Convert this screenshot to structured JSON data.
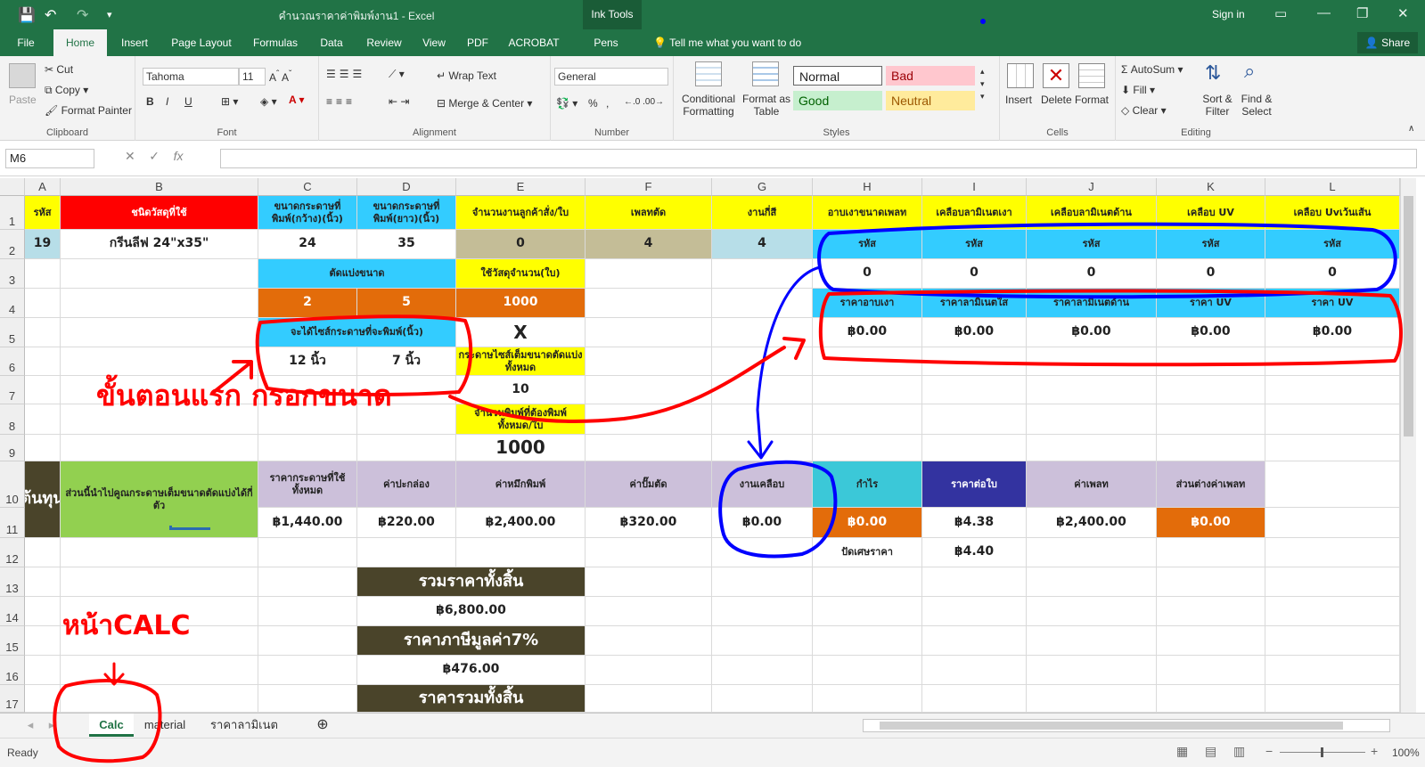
{
  "titlebar": {
    "title": "คำนวณราคาค่าพิมพ์งาน1 - Excel",
    "ink_tools": "Ink Tools",
    "sign_in": "Sign in"
  },
  "tabs": [
    "File",
    "Home",
    "Insert",
    "Page Layout",
    "Formulas",
    "Data",
    "Review",
    "View",
    "PDF",
    "ACROBAT",
    "Pens"
  ],
  "tell_me": "Tell me what you want to do",
  "share": "Share",
  "ribbon": {
    "clipboard": {
      "paste": "Paste",
      "cut": "Cut",
      "copy": "Copy",
      "format_painter": "Format Painter",
      "label": "Clipboard"
    },
    "font": {
      "name": "Tahoma",
      "size": "11",
      "bold": "B",
      "italic": "I",
      "underline": "U",
      "label": "Font"
    },
    "alignment": {
      "wrap": "Wrap Text",
      "merge": "Merge & Center",
      "label": "Alignment"
    },
    "number": {
      "format": "General",
      "percent": "%",
      "comma": ",",
      "label": "Number"
    },
    "styles": {
      "conditional": "Conditional Formatting",
      "format_table": "Format as Table",
      "normal": "Normal",
      "bad": "Bad",
      "good": "Good",
      "neutral": "Neutral",
      "label": "Styles"
    },
    "cells": {
      "insert": "Insert",
      "delete": "Delete",
      "format": "Format",
      "label": "Cells"
    },
    "editing": {
      "autosum": "AutoSum",
      "fill": "Fill",
      "clear": "Clear",
      "sort": "Sort & Filter",
      "find": "Find & Select",
      "label": "Editing"
    }
  },
  "formula_bar": {
    "name_box": "M6",
    "fx": "fx",
    "value": ""
  },
  "columns": [
    "A",
    "B",
    "C",
    "D",
    "E",
    "F",
    "G",
    "H",
    "I",
    "J",
    "K",
    "L"
  ],
  "rows": [
    "1",
    "2",
    "3",
    "4",
    "5",
    "6",
    "7",
    "8",
    "9",
    "10",
    "11",
    "12",
    "13",
    "14",
    "15",
    "16",
    "17"
  ],
  "cells": {
    "A1": "รหัส",
    "B1": "ชนิดวัสดุที่ใช้",
    "C1": "ขนาดกระดาษที่พิมพ์(กว้าง)(นิ้ว)",
    "D1": "ขนาดกระดาษที่พิมพ์(ยาว)(นิ้ว)",
    "E1": "จำนวนงานลูกค้าสั่ง/ใบ",
    "F1": "เพลทตัด",
    "G1": "งานกี่สี",
    "H1": "อาบเงาขนาดเพลท",
    "I1": "เคลือบลามิเนตเงา",
    "J1": "เคลือบลามิเนตด้าน",
    "K1": "เคลือบ UV",
    "L1": "เคลือบ Uvเว้นเส้น",
    "A2": "19",
    "B2": "กรีนลีฟ 24\"x35\"",
    "C2": "24",
    "D2": "35",
    "E2": "0",
    "F2": "4",
    "G2": "4",
    "H2": "รหัส",
    "I2": "รหัส",
    "J2": "รหัส",
    "K2": "รหัส",
    "L2": "รหัส",
    "C3": "ตัดแบ่งขนาด",
    "E3": "ใช้วัสดุจำนวน(ใบ)",
    "H3": "0",
    "I3": "0",
    "J3": "0",
    "K3": "0",
    "L3": "0",
    "C4": "2",
    "D4": "5",
    "E4": "1000",
    "H4": "ราคาอาบเงา",
    "I4": "ราคาลามิเนตใส",
    "J4": "ราคาลามิเนตด้าน",
    "K4": "ราคา UV",
    "L4": "ราคา UV",
    "C5": "จะได้ไซส์กระดาษที่จะพิมพ์(นิ้ว)",
    "E5": "X",
    "H5": "฿0.00",
    "I5": "฿0.00",
    "J5": "฿0.00",
    "K5": "฿0.00",
    "L5": "฿0.00",
    "C6": "12 นิ้ว",
    "D6": "7 นิ้ว",
    "E6": "กระดาษไซส์เต็มขนาดตัดแบ่งทั้งหมด",
    "E7": "10",
    "E8": "จำนวนพิมพ์ที่ต้องพิมพ์ทั้งหมด/ใบ",
    "E9": "1000",
    "A10": "ต้นทุน",
    "B10": "ส่วนนี้นำไปคูณกระดาษเต็มขนาดตัดแบ่งได้กี่ตัว",
    "C10": "ราคากระดาษที่ใช้ทั้งหมด",
    "D10": "ค่าปะกล่อง",
    "E10": "ค่าหมึกพิมพ์",
    "F10": "ค่าปั๊มตัด",
    "G10": "งานเคลือบ",
    "H10": "กำไร",
    "I10": "ราคาต่อใบ",
    "J10": "ค่าเพลท",
    "K10": "ส่วนต่างค่าเพลท",
    "C11": "฿1,440.00",
    "D11": "฿220.00",
    "E11": "฿2,400.00",
    "F11": "฿320.00",
    "G11": "฿0.00",
    "H11": "฿0.00",
    "I11": "฿4.38",
    "J11": "฿2,400.00",
    "K11": "฿0.00",
    "H12": "ปัดเศษราคา",
    "I12": "฿4.40",
    "D13": "รวมราคาทั้งสิ้น",
    "D14": "฿6,800.00",
    "D15": "ราคาภาษีมูลค่า7%",
    "D16": "฿476.00",
    "D17": "ราคารวมทั้งสิ้น"
  },
  "annotations": {
    "left_note": "ขั้นตอนแรก กรอกขนาด",
    "calc_note": "หน้าCALC"
  },
  "sheet_tabs": [
    "Calc",
    "material",
    "ราคาลามิเนต"
  ],
  "status": {
    "ready": "Ready",
    "zoom": "100%"
  },
  "colors": {
    "excel_green": "#217346",
    "yellow": "#ffff00",
    "red": "#ff0000",
    "cyan": "#33ccff",
    "orange": "#e36c0a",
    "lavender": "#ccc0da",
    "tan": "#c4bd97",
    "light_blue": "#b7dee8",
    "dark_olive": "#4a442a",
    "navy": "#3333a0",
    "teal": "#3bc8d8",
    "green": "#92d050",
    "annotation_red": "#ff0000",
    "annotation_blue": "#0000ff"
  }
}
